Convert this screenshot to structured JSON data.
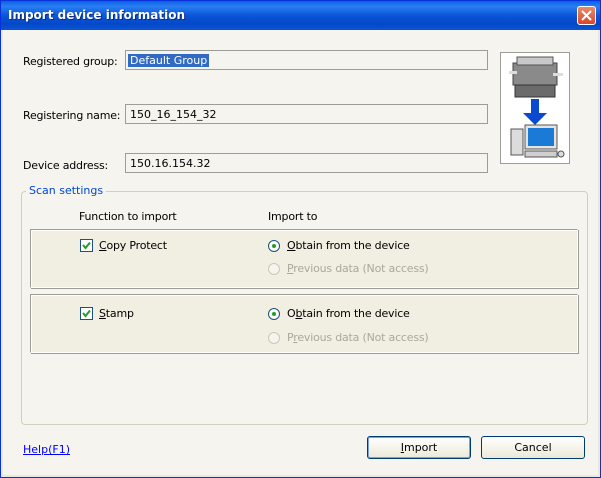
{
  "window": {
    "title": "Import device information"
  },
  "form": {
    "registered_group_label": "Registered group:",
    "registered_group_value": "Default Group",
    "registering_name_label": "Registering name:",
    "registering_name_value": "150_16_154_32",
    "device_address_label": "Device address:",
    "device_address_value": "150.16.154.32"
  },
  "scan_settings": {
    "title": "Scan settings",
    "col_function": "Function to import",
    "col_import_to": "Import to",
    "rows": [
      {
        "function_label": "Copy Protect",
        "mnemonic": "C",
        "rest": "opy Protect",
        "checked": true,
        "option1": "Obtain from the device",
        "option1_mnemonic": "O",
        "option1_rest": "btain from the device",
        "option2": "Previous data (Not access)",
        "option2_mnemonic": "P",
        "option2_rest": "revious data (Not access)"
      },
      {
        "function_label": "Stamp",
        "mnemonic": "S",
        "rest": "tamp",
        "checked": true,
        "option1": "Obtain from the device",
        "option1_pre": "O",
        "option1_mnemonic": "b",
        "option1_rest": "tain from the device",
        "option2": "Previous data (Not access)",
        "option2_mnemonic": "r",
        "option2_pre": "P",
        "option2_rest": "evious data (Not access)"
      }
    ]
  },
  "footer": {
    "help_link": "Help(F1)",
    "import_button": "Import",
    "import_mnemonic": "I",
    "import_rest": "mport",
    "cancel_button": "Cancel"
  },
  "colors": {
    "titlebar": "#0a55d8",
    "accent": "#0046d5",
    "radio_dot": "#21a121",
    "selection": "#316ac5"
  },
  "icons": {
    "close": "close-icon",
    "device_transfer": "printer-to-computer-icon"
  }
}
